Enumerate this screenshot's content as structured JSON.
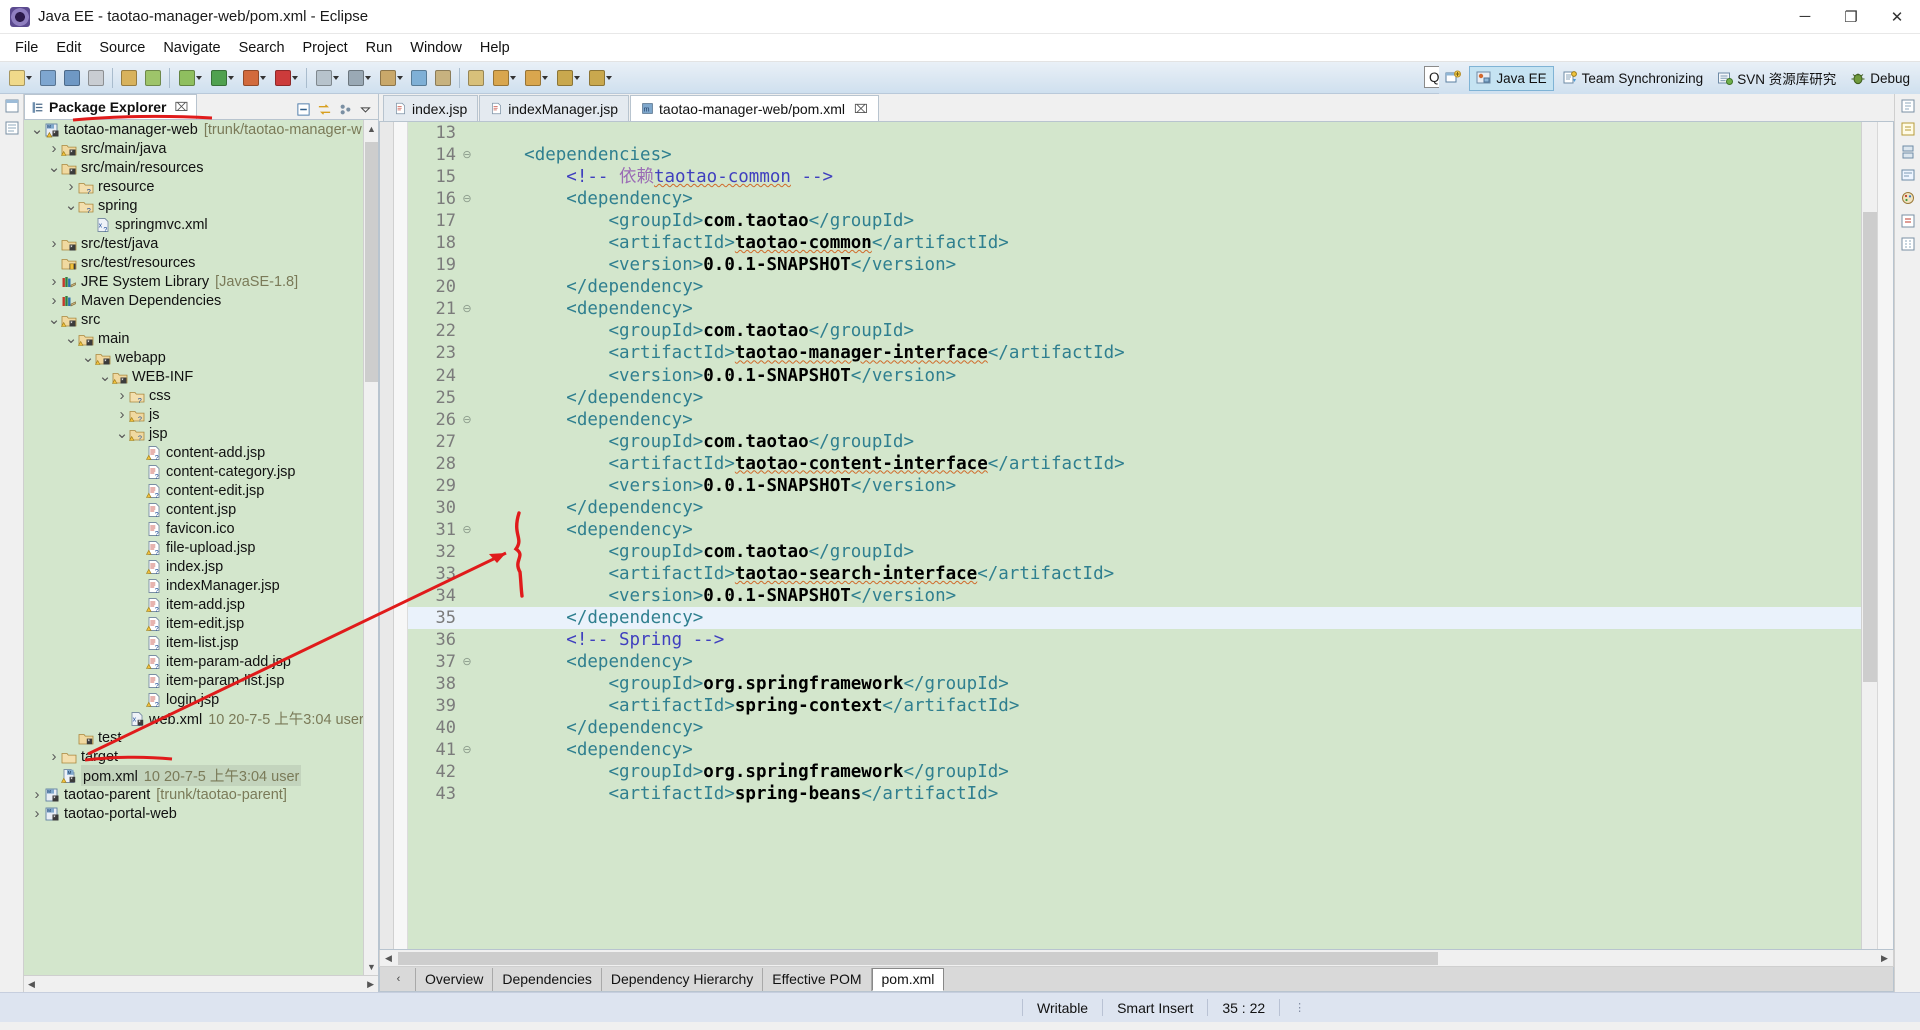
{
  "window": {
    "title": "Java EE - taotao-manager-web/pom.xml - Eclipse",
    "app_icon": "eclipse-icon",
    "controls": {
      "minimize": "─",
      "maximize": "❐",
      "close": "✕"
    }
  },
  "menubar": {
    "items": [
      "File",
      "Edit",
      "Source",
      "Navigate",
      "Search",
      "Project",
      "Run",
      "Window",
      "Help"
    ]
  },
  "toolbar": {
    "quick_access_placeholder": "Quick Access",
    "quick_access_value": "",
    "groups": [
      {
        "name": "new-group",
        "buttons": [
          {
            "name": "new-button",
            "color": "#f0d98a",
            "caret": true
          },
          {
            "name": "save-button",
            "color": "#7ea6d0",
            "caret": false
          },
          {
            "name": "save-all-button",
            "color": "#6f98c4",
            "caret": false
          },
          {
            "name": "print-button",
            "color": "#c9cdd2",
            "caret": false
          }
        ]
      },
      {
        "name": "build-group",
        "buttons": [
          {
            "name": "build-all-button",
            "color": "#d8b25c",
            "caret": false
          },
          {
            "name": "refresh-button",
            "color": "#9ec46a",
            "caret": false
          }
        ]
      },
      {
        "name": "debug-group",
        "buttons": [
          {
            "name": "debug-button",
            "color": "#8fbf5f",
            "caret": true
          },
          {
            "name": "run-button",
            "color": "#4fa14f",
            "caret": true
          },
          {
            "name": "external-tools-button",
            "color": "#d26a3c",
            "caret": true
          },
          {
            "name": "coverage-button",
            "color": "#cc3b3b",
            "caret": true
          }
        ]
      },
      {
        "name": "server-group",
        "buttons": [
          {
            "name": "new-server-button",
            "color": "#b7c3cc",
            "caret": true
          },
          {
            "name": "profile-button",
            "color": "#9aa9b5",
            "caret": true
          },
          {
            "name": "deploy-button",
            "color": "#c9a86a",
            "caret": true
          },
          {
            "name": "search-button",
            "color": "#7fb0d6",
            "caret": false
          },
          {
            "name": "open-type-button",
            "color": "#c7b27f",
            "caret": false
          }
        ]
      },
      {
        "name": "nav-group",
        "buttons": [
          {
            "name": "last-edit-button",
            "color": "#d8c07a",
            "caret": false
          },
          {
            "name": "back-button",
            "color": "#d9a64e",
            "caret": true
          },
          {
            "name": "forward-button",
            "color": "#d9a64e",
            "caret": true
          },
          {
            "name": "next-annotation-button",
            "color": "#c9a84e",
            "caret": true
          },
          {
            "name": "previous-annotation-button",
            "color": "#c9a84e",
            "caret": true
          }
        ]
      }
    ],
    "perspectives": [
      {
        "name": "open-perspective-button",
        "label": "",
        "icon": "open-perspective-icon",
        "active": false
      },
      {
        "name": "perspective-java-ee",
        "label": "Java EE",
        "icon": "java-ee-icon",
        "active": true
      },
      {
        "name": "perspective-team-synchronizing",
        "label": "Team Synchronizing",
        "icon": "team-sync-icon",
        "active": false
      },
      {
        "name": "perspective-svn",
        "label": "SVN 资源库研究",
        "icon": "svn-icon",
        "active": false
      },
      {
        "name": "perspective-debug",
        "label": "Debug",
        "icon": "debug-perspective-icon",
        "active": false
      }
    ]
  },
  "explorer": {
    "tab_label": "Package Explorer",
    "tab_close": "⌧",
    "view_actions": [
      {
        "name": "collapse-all-icon"
      },
      {
        "name": "link-with-editor-icon"
      },
      {
        "name": "focus-on-active-task-icon"
      },
      {
        "name": "view-menu-icon"
      }
    ],
    "tree": [
      {
        "indent": 0,
        "twist": "v",
        "icon": "project-maven-warn",
        "label": "taotao-manager-web",
        "meta": "[trunk/taotao-manager-w",
        "selected": false,
        "underline": true
      },
      {
        "indent": 1,
        "twist": ">",
        "icon": "source-folder-warn",
        "label": "src/main/java",
        "meta": ""
      },
      {
        "indent": 1,
        "twist": "v",
        "icon": "source-folder",
        "label": "src/main/resources",
        "meta": ""
      },
      {
        "indent": 2,
        "twist": ">",
        "icon": "folder-q",
        "label": "resource",
        "meta": ""
      },
      {
        "indent": 2,
        "twist": "v",
        "icon": "folder-q",
        "label": "spring",
        "meta": ""
      },
      {
        "indent": 3,
        "twist": "",
        "icon": "xml-file",
        "label": "springmvc.xml",
        "meta": ""
      },
      {
        "indent": 1,
        "twist": ">",
        "icon": "source-folder",
        "label": "src/test/java",
        "meta": ""
      },
      {
        "indent": 1,
        "twist": "",
        "icon": "source-folder-excl",
        "label": "src/test/resources",
        "meta": ""
      },
      {
        "indent": 1,
        "twist": ">",
        "icon": "library",
        "label": "JRE System Library",
        "meta": "[JavaSE-1.8]"
      },
      {
        "indent": 1,
        "twist": ">",
        "icon": "library",
        "label": "Maven Dependencies",
        "meta": ""
      },
      {
        "indent": 1,
        "twist": "v",
        "icon": "folder-warn",
        "label": "src",
        "meta": ""
      },
      {
        "indent": 2,
        "twist": "v",
        "icon": "folder-warn",
        "label": "main",
        "meta": ""
      },
      {
        "indent": 3,
        "twist": "v",
        "icon": "folder-warn",
        "label": "webapp",
        "meta": ""
      },
      {
        "indent": 4,
        "twist": "v",
        "icon": "folder-warn",
        "label": "WEB-INF",
        "meta": ""
      },
      {
        "indent": 5,
        "twist": ">",
        "icon": "folder-q",
        "label": "css",
        "meta": ""
      },
      {
        "indent": 5,
        "twist": ">",
        "icon": "folder-warn-q",
        "label": "js",
        "meta": ""
      },
      {
        "indent": 5,
        "twist": "v",
        "icon": "folder-warn-q",
        "label": "jsp",
        "meta": ""
      },
      {
        "indent": 6,
        "twist": "",
        "icon": "file-warn",
        "label": "content-add.jsp",
        "meta": ""
      },
      {
        "indent": 6,
        "twist": "",
        "icon": "file",
        "label": "content-category.jsp",
        "meta": ""
      },
      {
        "indent": 6,
        "twist": "",
        "icon": "file-warn",
        "label": "content-edit.jsp",
        "meta": ""
      },
      {
        "indent": 6,
        "twist": "",
        "icon": "file",
        "label": "content.jsp",
        "meta": ""
      },
      {
        "indent": 6,
        "twist": "",
        "icon": "file",
        "label": "favicon.ico",
        "meta": ""
      },
      {
        "indent": 6,
        "twist": "",
        "icon": "file-warn",
        "label": "file-upload.jsp",
        "meta": ""
      },
      {
        "indent": 6,
        "twist": "",
        "icon": "file-warn",
        "label": "index.jsp",
        "meta": ""
      },
      {
        "indent": 6,
        "twist": "",
        "icon": "file",
        "label": "indexManager.jsp",
        "meta": ""
      },
      {
        "indent": 6,
        "twist": "",
        "icon": "file-warn",
        "label": "item-add.jsp",
        "meta": ""
      },
      {
        "indent": 6,
        "twist": "",
        "icon": "file-warn",
        "label": "item-edit.jsp",
        "meta": ""
      },
      {
        "indent": 6,
        "twist": "",
        "icon": "file",
        "label": "item-list.jsp",
        "meta": ""
      },
      {
        "indent": 6,
        "twist": "",
        "icon": "file-warn",
        "label": "item-param-add.jsp",
        "meta": ""
      },
      {
        "indent": 6,
        "twist": "",
        "icon": "file",
        "label": "item-param-list.jsp",
        "meta": ""
      },
      {
        "indent": 6,
        "twist": "",
        "icon": "file-warn",
        "label": "login.jsp",
        "meta": ""
      },
      {
        "indent": 5,
        "twist": "",
        "icon": "xml-file-excl",
        "label": "web.xml",
        "meta": "10  20-7-5 上午3:04  user"
      },
      {
        "indent": 2,
        "twist": "",
        "icon": "folder-excl",
        "label": "test",
        "meta": ""
      },
      {
        "indent": 1,
        "twist": ">",
        "icon": "folder-plain",
        "label": "target",
        "meta": ""
      },
      {
        "indent": 1,
        "twist": "",
        "icon": "pom-warn",
        "label": "pom.xml",
        "meta": "10  20-7-5 上午3:04  user",
        "selected": true,
        "underline": true
      },
      {
        "indent": 0,
        "twist": ">",
        "icon": "project-maven",
        "label": "taotao-parent",
        "meta": "[trunk/taotao-parent]"
      },
      {
        "indent": 0,
        "twist": ">",
        "icon": "project-maven",
        "label": "taotao-portal-web",
        "meta": ""
      }
    ]
  },
  "editor": {
    "tabs": [
      {
        "label": "index.jsp",
        "icon": "jsp-file-icon",
        "active": false,
        "closeable": false
      },
      {
        "label": "indexManager.jsp",
        "icon": "jsp-file-icon",
        "active": false,
        "closeable": false
      },
      {
        "label": "taotao-manager-web/pom.xml",
        "icon": "maven-pom-icon",
        "active": true,
        "closeable": true,
        "close": "⌧"
      }
    ],
    "first_line": 13,
    "current_line": 35,
    "lines": [
      {
        "n": 13,
        "fold": "",
        "indent": 0,
        "tokens": []
      },
      {
        "n": 14,
        "fold": "-",
        "indent": 1,
        "tokens": [
          {
            "t": "tag",
            "v": "<dependencies>"
          }
        ]
      },
      {
        "n": 15,
        "fold": "",
        "indent": 2,
        "tokens": [
          {
            "t": "comment",
            "v": "<!-- "
          },
          {
            "t": "comment-cn",
            "v": "依赖"
          },
          {
            "t": "comment-sq",
            "v": "taotao-common"
          },
          {
            "t": "comment",
            "v": " -->"
          }
        ]
      },
      {
        "n": 16,
        "fold": "-",
        "indent": 2,
        "tokens": [
          {
            "t": "tag",
            "v": "<dependency>"
          }
        ]
      },
      {
        "n": 17,
        "fold": "",
        "indent": 3,
        "tokens": [
          {
            "t": "tag",
            "v": "<groupId>"
          },
          {
            "t": "text",
            "v": "com.taotao"
          },
          {
            "t": "tag",
            "v": "</groupId>"
          }
        ]
      },
      {
        "n": 18,
        "fold": "",
        "indent": 3,
        "tokens": [
          {
            "t": "tag",
            "v": "<artifactId>"
          },
          {
            "t": "text-sq",
            "v": "taotao-common"
          },
          {
            "t": "tag",
            "v": "</artifactId>"
          }
        ]
      },
      {
        "n": 19,
        "fold": "",
        "indent": 3,
        "tokens": [
          {
            "t": "tag",
            "v": "<version>"
          },
          {
            "t": "text",
            "v": "0.0.1-SNAPSHOT"
          },
          {
            "t": "tag",
            "v": "</version>"
          }
        ]
      },
      {
        "n": 20,
        "fold": "",
        "indent": 2,
        "tokens": [
          {
            "t": "tag",
            "v": "</dependency>"
          }
        ]
      },
      {
        "n": 21,
        "fold": "-",
        "indent": 2,
        "tokens": [
          {
            "t": "tag",
            "v": "<dependency>"
          }
        ]
      },
      {
        "n": 22,
        "fold": "",
        "indent": 3,
        "tokens": [
          {
            "t": "tag",
            "v": "<groupId>"
          },
          {
            "t": "text",
            "v": "com.taotao"
          },
          {
            "t": "tag",
            "v": "</groupId>"
          }
        ]
      },
      {
        "n": 23,
        "fold": "",
        "indent": 3,
        "tokens": [
          {
            "t": "tag",
            "v": "<artifactId>"
          },
          {
            "t": "text-sq",
            "v": "taotao-manager-interface"
          },
          {
            "t": "tag",
            "v": "</artifactId>"
          }
        ]
      },
      {
        "n": 24,
        "fold": "",
        "indent": 3,
        "tokens": [
          {
            "t": "tag",
            "v": "<version>"
          },
          {
            "t": "text",
            "v": "0.0.1-SNAPSHOT"
          },
          {
            "t": "tag",
            "v": "</version>"
          }
        ]
      },
      {
        "n": 25,
        "fold": "",
        "indent": 2,
        "tokens": [
          {
            "t": "tag",
            "v": "</dependency>"
          }
        ]
      },
      {
        "n": 26,
        "fold": "-",
        "indent": 2,
        "tokens": [
          {
            "t": "tag",
            "v": "<dependency>"
          }
        ]
      },
      {
        "n": 27,
        "fold": "",
        "indent": 3,
        "tokens": [
          {
            "t": "tag",
            "v": "<groupId>"
          },
          {
            "t": "text",
            "v": "com.taotao"
          },
          {
            "t": "tag",
            "v": "</groupId>"
          }
        ]
      },
      {
        "n": 28,
        "fold": "",
        "indent": 3,
        "tokens": [
          {
            "t": "tag",
            "v": "<artifactId>"
          },
          {
            "t": "text-sq",
            "v": "taotao-content-interface"
          },
          {
            "t": "tag",
            "v": "</artifactId>"
          }
        ]
      },
      {
        "n": 29,
        "fold": "",
        "indent": 3,
        "tokens": [
          {
            "t": "tag",
            "v": "<version>"
          },
          {
            "t": "text",
            "v": "0.0.1-SNAPSHOT"
          },
          {
            "t": "tag",
            "v": "</version>"
          }
        ]
      },
      {
        "n": 30,
        "fold": "",
        "indent": 2,
        "tokens": [
          {
            "t": "tag",
            "v": "</dependency>"
          }
        ]
      },
      {
        "n": 31,
        "fold": "-",
        "indent": 2,
        "tokens": [
          {
            "t": "tag",
            "v": "<dependency>"
          }
        ]
      },
      {
        "n": 32,
        "fold": "",
        "indent": 3,
        "tokens": [
          {
            "t": "tag",
            "v": "<groupId>"
          },
          {
            "t": "text",
            "v": "com.taotao"
          },
          {
            "t": "tag",
            "v": "</groupId>"
          }
        ]
      },
      {
        "n": 33,
        "fold": "",
        "indent": 3,
        "tokens": [
          {
            "t": "tag",
            "v": "<artifactId>"
          },
          {
            "t": "text-sq",
            "v": "taotao-search-interface"
          },
          {
            "t": "tag",
            "v": "</artifactId>"
          }
        ]
      },
      {
        "n": 34,
        "fold": "",
        "indent": 3,
        "tokens": [
          {
            "t": "tag",
            "v": "<version>"
          },
          {
            "t": "text",
            "v": "0.0.1-SNAPSHOT"
          },
          {
            "t": "tag",
            "v": "</version>"
          }
        ]
      },
      {
        "n": 35,
        "fold": "",
        "indent": 2,
        "tokens": [
          {
            "t": "tag",
            "v": "</dependency>"
          }
        ],
        "current": true
      },
      {
        "n": 36,
        "fold": "",
        "indent": 2,
        "tokens": [
          {
            "t": "comment",
            "v": "<!-- Spring -->"
          }
        ]
      },
      {
        "n": 37,
        "fold": "-",
        "indent": 2,
        "tokens": [
          {
            "t": "tag",
            "v": "<dependency>"
          }
        ]
      },
      {
        "n": 38,
        "fold": "",
        "indent": 3,
        "tokens": [
          {
            "t": "tag",
            "v": "<groupId>"
          },
          {
            "t": "text",
            "v": "org.springframework"
          },
          {
            "t": "tag",
            "v": "</groupId>"
          }
        ]
      },
      {
        "n": 39,
        "fold": "",
        "indent": 3,
        "tokens": [
          {
            "t": "tag",
            "v": "<artifactId>"
          },
          {
            "t": "text",
            "v": "spring-context"
          },
          {
            "t": "tag",
            "v": "</artifactId>"
          }
        ]
      },
      {
        "n": 40,
        "fold": "",
        "indent": 2,
        "tokens": [
          {
            "t": "tag",
            "v": "</dependency>"
          }
        ]
      },
      {
        "n": 41,
        "fold": "-",
        "indent": 2,
        "tokens": [
          {
            "t": "tag",
            "v": "<dependency>"
          }
        ]
      },
      {
        "n": 42,
        "fold": "",
        "indent": 3,
        "tokens": [
          {
            "t": "tag",
            "v": "<groupId>"
          },
          {
            "t": "text",
            "v": "org.springframework"
          },
          {
            "t": "tag",
            "v": "</groupId>"
          }
        ]
      },
      {
        "n": 43,
        "fold": "",
        "indent": 3,
        "tokens": [
          {
            "t": "tag",
            "v": "<artifactId>"
          },
          {
            "t": "text",
            "v": "spring-beans"
          },
          {
            "t": "tag",
            "v": "</artifactId>"
          }
        ]
      }
    ],
    "form_tabs": [
      {
        "label": "Overview",
        "active": false
      },
      {
        "label": "Dependencies",
        "active": false
      },
      {
        "label": "Dependency Hierarchy",
        "active": false
      },
      {
        "label": "Effective POM",
        "active": false
      },
      {
        "label": "pom.xml",
        "active": true
      }
    ]
  },
  "statusbar": {
    "writable": "Writable",
    "insert_mode": "Smart Insert",
    "position": "35 : 22"
  },
  "colors": {
    "editor_background": "#d3e6cc",
    "current_line": "#eaf2fb",
    "tag": "#2f7f8f",
    "text": "#000000",
    "comment": "#3f3fbf",
    "annotation_red": "#e01b1b",
    "tree_background": "#d3e6cc",
    "statusbar": "#dde4f0"
  }
}
